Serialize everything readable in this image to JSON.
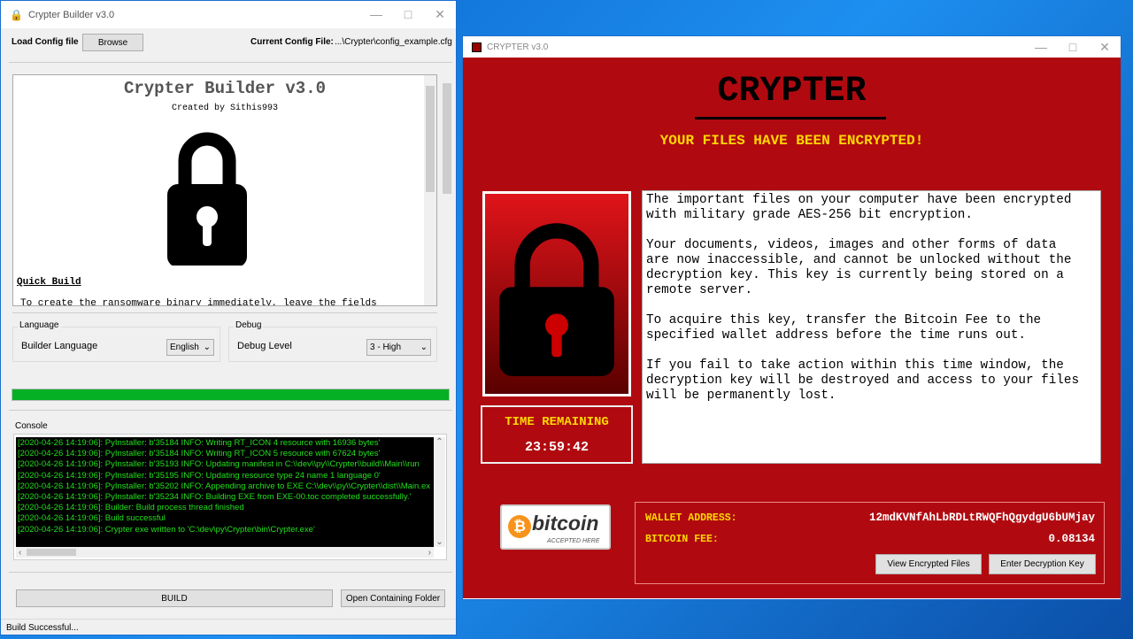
{
  "builder": {
    "title": "Crypter Builder v3.0",
    "load_config_label": "Load Config file",
    "browse_label": "Browse",
    "current_config_label": "Current Config File:",
    "current_config_value": "...\\Crypter\\config_example.cfg",
    "info_title": "Crypter Builder v3.0",
    "info_subtitle": "Created by Sithis993",
    "quick_build_heading": "Quick Build",
    "quick_build_text": "To create the ransomware binary immediately, leave the fields",
    "language_group": "Language",
    "language_label": "Builder Language",
    "language_value": "English",
    "debug_group": "Debug",
    "debug_label": "Debug Level",
    "debug_value": "3 - High",
    "progress_percent": 100,
    "progress_color": "#06b025",
    "console_label": "Console",
    "console_lines": [
      "[2020-04-26 14:19:06]: PyInstaller: b'35184 INFO: Writing RT_ICON 4 resource with 16936 bytes'",
      "[2020-04-26 14:19:06]: PyInstaller: b'35184 INFO: Writing RT_ICON 5 resource with 67624 bytes'",
      "[2020-04-26 14:19:06]: PyInstaller: b'35193 INFO: Updating manifest in C:\\\\dev\\\\py\\\\Crypter\\\\build\\\\Main\\\\run",
      "[2020-04-26 14:19:06]: PyInstaller: b'35195 INFO: Updating resource type 24 name 1 language 0'",
      "[2020-04-26 14:19:06]: PyInstaller: b'35202 INFO: Appending archive to EXE C:\\\\dev\\\\py\\\\Crypter\\\\dist\\\\Main.ex",
      "[2020-04-26 14:19:06]: PyInstaller: b'35234 INFO: Building EXE from EXE-00.toc completed successfully.'",
      "[2020-04-26 14:19:06]: Builder: Build process thread finished",
      "[2020-04-26 14:19:06]: Build successful",
      "[2020-04-26 14:19:06]: Crypter exe written to 'C:\\dev\\py\\Crypter\\bin\\Crypter.exe'"
    ],
    "build_label": "BUILD",
    "open_folder_label": "Open Containing Folder",
    "status": "Build Successful..."
  },
  "crypter": {
    "title": "CRYPTER v3.0",
    "heading": "CRYPTER",
    "subheading": "YOUR FILES HAVE BEEN ENCRYPTED!",
    "message": [
      "The important files on your computer have been encrypted with military grade AES-256 bit encryption.",
      "Your documents, videos, images and other forms of data are now inaccessible, and cannot be unlocked without the decryption key. This key is currently being stored on a remote server.",
      "To acquire this key, transfer the Bitcoin Fee to the specified wallet address before the time runs out.",
      "If you fail to take action within this time window, the decryption key will be destroyed and access to your files will be permanently lost."
    ],
    "time_label": "TIME REMAINING",
    "time_value": "23:59:42",
    "bitcoin_logo": "bitcoin",
    "bitcoin_tagline": "ACCEPTED HERE",
    "wallet_label": "WALLET ADDRESS:",
    "wallet_value": "12mdKVNfAhLbRDLtRWQFhQgydgU6bUMjay",
    "fee_label": "BITCOIN FEE:",
    "fee_value": "0.08134",
    "view_files_label": "View Encrypted Files",
    "enter_key_label": "Enter Decryption Key",
    "bg_color": "#b00a10",
    "accent_color": "#ffd800"
  }
}
